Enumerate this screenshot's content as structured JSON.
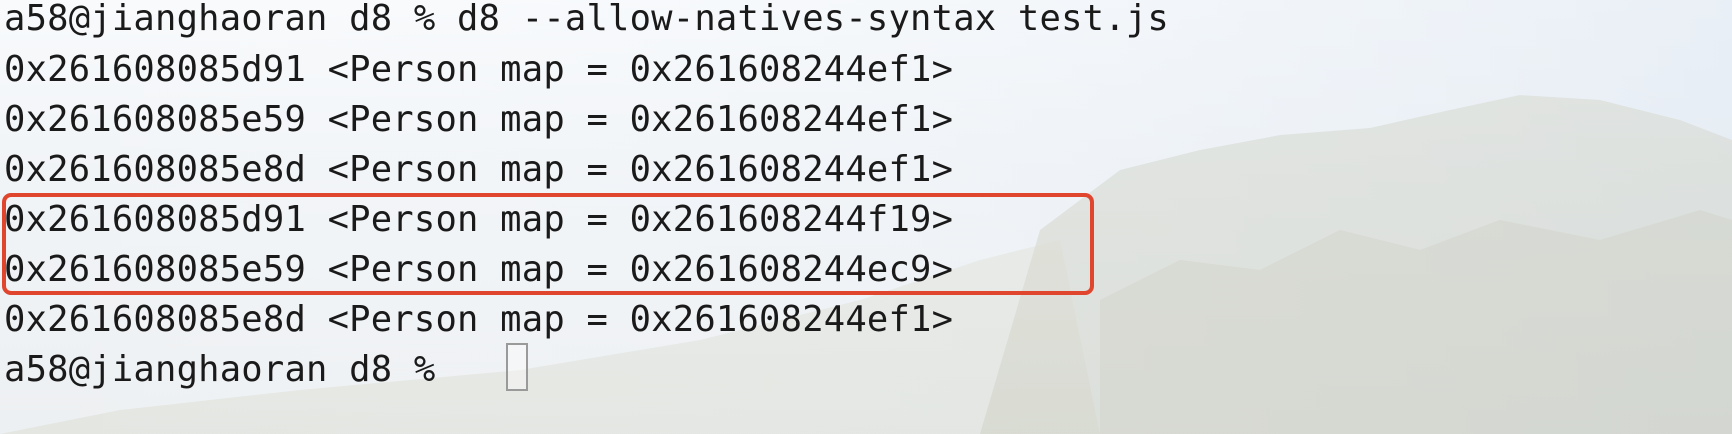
{
  "terminal": {
    "prompt": "a58@jianghaoran d8 % ",
    "command": "d8 --allow-natives-syntax test.js",
    "output_lines": [
      "0x261608085d91 <Person map = 0x261608244ef1>",
      "0x261608085e59 <Person map = 0x261608244ef1>",
      "0x261608085e8d <Person map = 0x261608244ef1>",
      "0x261608085d91 <Person map = 0x261608244f19>",
      "0x261608085e59 <Person map = 0x261608244ec9>",
      "0x261608085e8d <Person map = 0x261608244ef1>"
    ],
    "final_prompt": "a58@jianghaoran d8 % ",
    "highlight_color": "#e0452e"
  }
}
